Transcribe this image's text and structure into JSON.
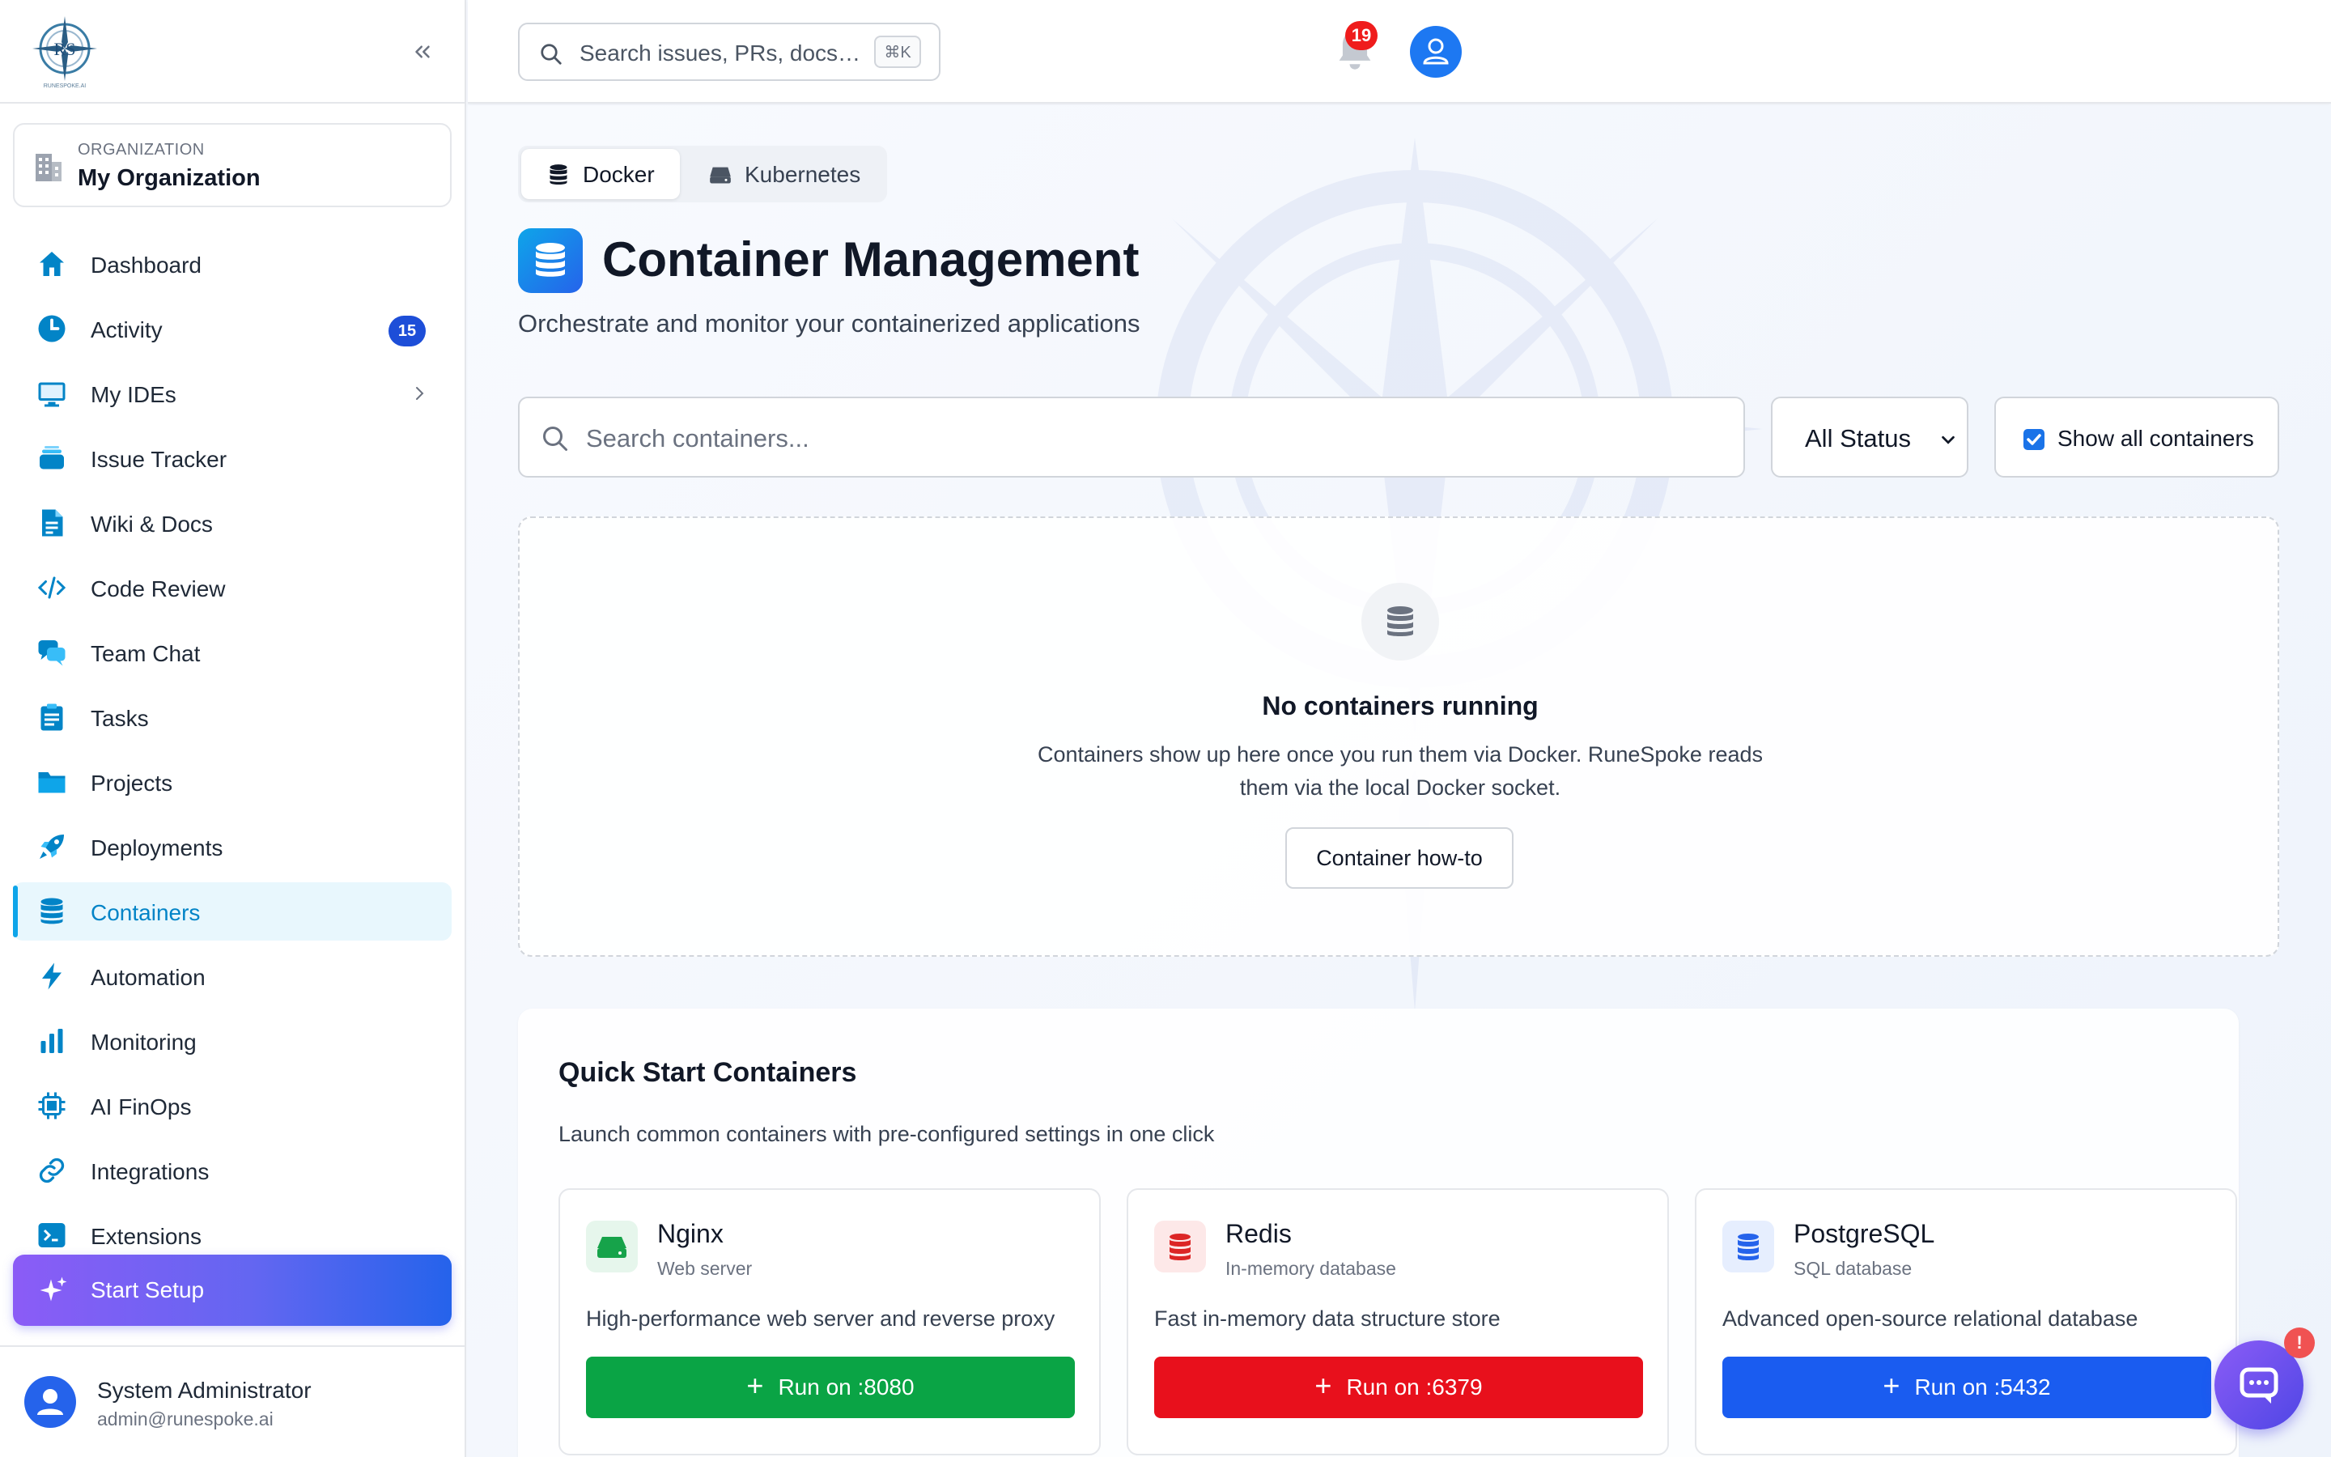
{
  "sidebar": {
    "org_label": "ORGANIZATION",
    "org_name": "My Organization",
    "items": [
      {
        "label": "Dashboard",
        "icon": "home-icon"
      },
      {
        "label": "Activity",
        "icon": "clock-icon",
        "badge": "15"
      },
      {
        "label": "My IDEs",
        "icon": "monitor-icon"
      },
      {
        "label": "Issue Tracker",
        "icon": "layers-icon"
      },
      {
        "label": "Wiki & Docs",
        "icon": "document-icon"
      },
      {
        "label": "Code Review",
        "icon": "code-icon"
      },
      {
        "label": "Team Chat",
        "icon": "chat-icon"
      },
      {
        "label": "Tasks",
        "icon": "clipboard-icon"
      },
      {
        "label": "Projects",
        "icon": "folder-icon"
      },
      {
        "label": "Deployments",
        "icon": "rocket-icon"
      },
      {
        "label": "Containers",
        "icon": "database-icon",
        "active": true
      },
      {
        "label": "Automation",
        "icon": "bolt-icon"
      },
      {
        "label": "Monitoring",
        "icon": "bar-chart-icon"
      },
      {
        "label": "AI FinOps",
        "icon": "chip-icon"
      },
      {
        "label": "Integrations",
        "icon": "link-icon"
      },
      {
        "label": "Extensions",
        "icon": "terminal-icon"
      }
    ],
    "start_setup": "Start Setup",
    "user_name": "System Administrator",
    "user_email": "admin@runespoke.ai"
  },
  "topbar": {
    "search_placeholder": "Search issues, PRs, docs…",
    "shortcut": "⌘K",
    "notification_count": "19"
  },
  "main": {
    "tabs": [
      {
        "label": "Docker"
      },
      {
        "label": "Kubernetes"
      }
    ],
    "title": "Container Management",
    "subtitle": "Orchestrate and monitor your containerized applications",
    "search_placeholder": "Search containers...",
    "status_filter": "All Status",
    "show_all_label": "Show all containers",
    "empty": {
      "title": "No containers running",
      "description": "Containers show up here once you run them via Docker. RuneSpoke reads them via the local Docker socket.",
      "button": "Container how-to"
    },
    "quick_start": {
      "title": "Quick Start Containers",
      "subtitle": "Launch common containers with pre-configured settings in one click",
      "templates": [
        {
          "name": "Nginx",
          "type": "Web server",
          "description": "High-performance web server and reverse proxy",
          "button": "Run on :8080",
          "color": "#0aa445"
        },
        {
          "name": "Redis",
          "type": "In-memory database",
          "description": "Fast in-memory data structure store",
          "button": "Run on :6379",
          "color": "#e8101c"
        },
        {
          "name": "PostgreSQL",
          "type": "SQL database",
          "description": "Advanced open-source relational database",
          "button": "Run on :5432",
          "color": "#1a5cf0"
        }
      ]
    }
  },
  "chat": {
    "alert": "!"
  },
  "colors": {
    "accent": "#0ea5e9",
    "primary": "#2563eb",
    "badge_red": "#ef1c1c"
  }
}
